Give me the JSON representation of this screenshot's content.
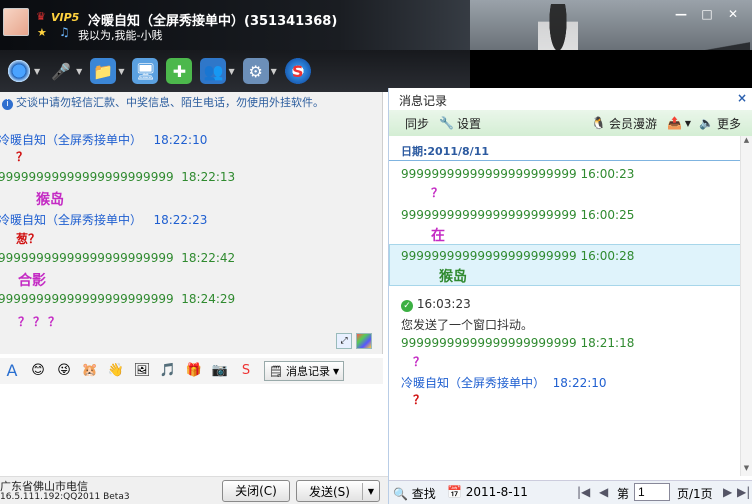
{
  "window": {
    "vip_label": "VIP5",
    "contact_name": "冷暖自知（全屏秀接单中）(351341368)",
    "signature": "我以为,我能-小贱",
    "min": "—",
    "max": "□",
    "close": "✕"
  },
  "toolbar_icons": [
    "webcam-icon",
    "microphone-icon",
    "file-transfer-icon",
    "remote-assist-icon",
    "app-add-icon",
    "group-chat-icon",
    "settings-icon",
    "qq-safe-icon"
  ],
  "chat": {
    "notice": "交谈中请勿轻信汇款、中奖信息、陌生电话，勿使用外挂软件。",
    "messages": [
      {
        "sender": "冷暖自知（全屏秀接单中）",
        "time": "18:22:10",
        "text": "？",
        "sender_color": "blue",
        "text_color": "red"
      },
      {
        "sender": "99999999999999999999999",
        "time": "18:22:13",
        "text": "猴岛",
        "sender_color": "green",
        "text_color": "magenta"
      },
      {
        "sender": "冷暖自知（全屏秀接单中）",
        "time": "18:22:23",
        "text": "葱？",
        "sender_color": "blue",
        "text_color": "red"
      },
      {
        "sender": "99999999999999999999999",
        "time": "18:22:42",
        "text": "合影",
        "sender_color": "green",
        "text_color": "magenta"
      },
      {
        "sender": "99999999999999999999999",
        "time": "18:24:29",
        "text": "？？？",
        "sender_color": "green",
        "text_color": "magenta"
      }
    ]
  },
  "input_tools": {
    "message_record": "消息记录"
  },
  "bottom": {
    "location": "广东省佛山市电信",
    "version": "16.5.111.192:QQ2011 Beta3",
    "close_label": "关闭(C)",
    "send_label": "发送(S)"
  },
  "history": {
    "title": "消息记录",
    "close": "×",
    "sync": "同步",
    "settings": "设置",
    "roaming": "会员漫游",
    "more": "更多",
    "date": "日期:2011/8/11",
    "messages": [
      {
        "sender": "99999999999999999999999",
        "time": "16:00:23",
        "text": "？",
        "color": "magenta"
      },
      {
        "sender": "99999999999999999999999",
        "time": "16:00:25",
        "text": "在",
        "color": "magenta"
      },
      {
        "sender": "99999999999999999999999",
        "time": "16:00:28",
        "text": "猴岛",
        "color": "green"
      }
    ],
    "shake_time": "16:03:23",
    "shake_text": "您发送了一个窗口抖动。",
    "messages2": [
      {
        "sender": "99999999999999999999999",
        "time": "18:21:18",
        "text": "？",
        "color": "magenta"
      },
      {
        "sender": "冷暖自知（全屏秀接单中）",
        "time": "18:22:10",
        "text": "？",
        "color": "red"
      }
    ],
    "search": "查找",
    "date_picker": "2011-8-11",
    "page_prefix": "第",
    "page_value": "1",
    "page_suffix": "页/1页"
  }
}
